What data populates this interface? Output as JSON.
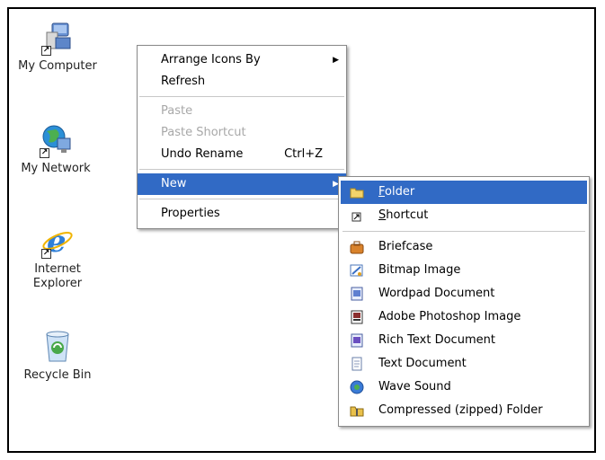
{
  "desktop": {
    "icons": [
      {
        "label": "My Computer",
        "icon": "my-computer-icon"
      },
      {
        "label": "My Network",
        "icon": "my-network-icon"
      },
      {
        "label": "Internet Explorer",
        "icon": "internet-explorer-icon"
      },
      {
        "label": "Recycle Bin",
        "icon": "recycle-bin-icon"
      }
    ]
  },
  "context_menu": {
    "arrange": "Arrange Icons By",
    "refresh": "Refresh",
    "paste": "Paste",
    "paste_shortcut": "Paste Shortcut",
    "undo_rename": "Undo Rename",
    "undo_shortcut": "Ctrl+Z",
    "new": "New",
    "properties": "Properties"
  },
  "new_submenu": {
    "folder_first": "F",
    "folder_rest": "older",
    "shortcut_first": "S",
    "shortcut_rest": "hortcut",
    "items": [
      {
        "label": "Briefcase",
        "icon": "briefcase-icon"
      },
      {
        "label": "Bitmap Image",
        "icon": "bitmap-image-icon"
      },
      {
        "label": "Wordpad Document",
        "icon": "wordpad-document-icon"
      },
      {
        "label": "Adobe Photoshop Image",
        "icon": "photoshop-image-icon"
      },
      {
        "label": "Rich Text Document",
        "icon": "rich-text-document-icon"
      },
      {
        "label": "Text Document",
        "icon": "text-document-icon"
      },
      {
        "label": "Wave Sound",
        "icon": "wave-sound-icon"
      },
      {
        "label": "Compressed (zipped) Folder",
        "icon": "zipped-folder-icon"
      }
    ]
  },
  "colors": {
    "highlight": "#316ac5",
    "disabled_text": "#a8a8a8"
  }
}
